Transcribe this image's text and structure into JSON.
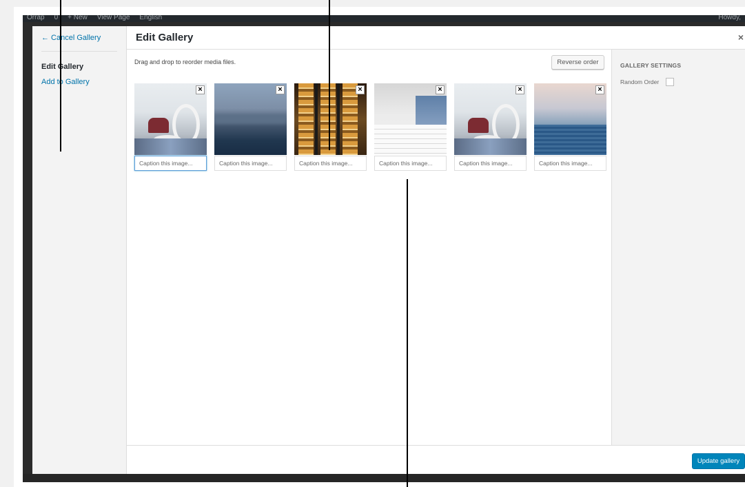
{
  "admin_bar": {
    "items": [
      "Orrap",
      "0",
      "+ New",
      "View Page",
      "English"
    ],
    "greeting": "Howdy,"
  },
  "menu": {
    "cancel_label": "← Cancel Gallery",
    "active_label": "Edit Gallery",
    "add_label": "Add to Gallery"
  },
  "title": "Edit Gallery",
  "close_label": "×",
  "instructions": "Drag and drop to reorder media files.",
  "reverse_label": "Reverse order",
  "caption_placeholder": "Caption this image...",
  "remove_label": "×",
  "thumbnails": [
    {
      "art": "lounge",
      "focused": true
    },
    {
      "art": "blur-water",
      "focused": false
    },
    {
      "art": "escalator",
      "focused": false
    },
    {
      "art": "white-room",
      "focused": false
    },
    {
      "art": "lounge",
      "focused": false
    },
    {
      "art": "sea",
      "focused": false
    }
  ],
  "settings": {
    "heading": "GALLERY SETTINGS",
    "random_order_label": "Random Order",
    "random_order_checked": false
  },
  "update_label": "Update gallery",
  "colors": {
    "primary": "#0085ba",
    "link": "#0073aa"
  }
}
